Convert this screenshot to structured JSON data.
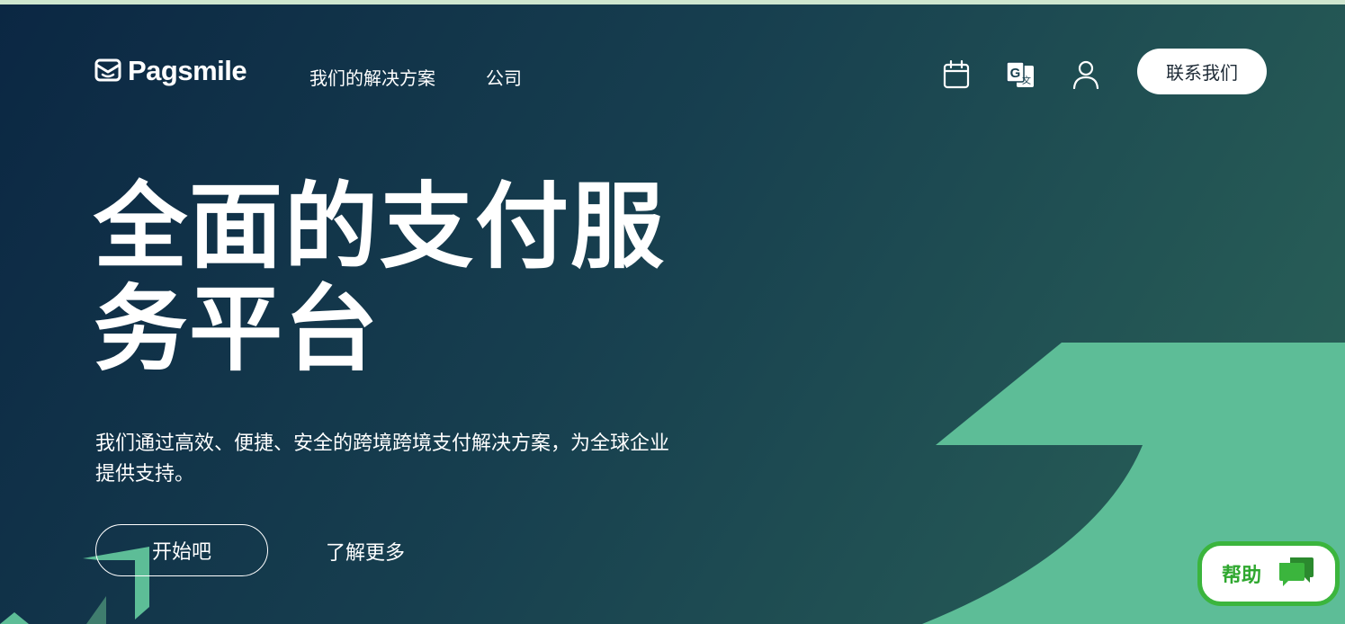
{
  "brand": {
    "name": "Pagsmile",
    "logo_icon": "envelope-smile-icon"
  },
  "nav": {
    "items": [
      {
        "label": "我们的解决方案"
      },
      {
        "label": "公司"
      }
    ]
  },
  "header_icons": [
    "calendar-icon",
    "translate-icon",
    "user-icon"
  ],
  "contact_button": {
    "label": "联系我们"
  },
  "hero": {
    "headline_line1": "全面的支付服",
    "headline_line2": "务平台",
    "subtitle_line1": "我们通过高效、便捷、安全的跨境跨境支付解决方案，为全球企业",
    "subtitle_line2": "提供支持。",
    "primary_button": "开始吧",
    "secondary_link": "了解更多"
  },
  "help_widget": {
    "label": "帮助",
    "icon": "chat-bubbles-icon"
  },
  "colors": {
    "bg_dark": "#0b2743",
    "bg_light": "#2b6458",
    "accent_green": "#5dbd97",
    "help_green": "#3bb53d",
    "top_strip": "#cfe6cf"
  }
}
